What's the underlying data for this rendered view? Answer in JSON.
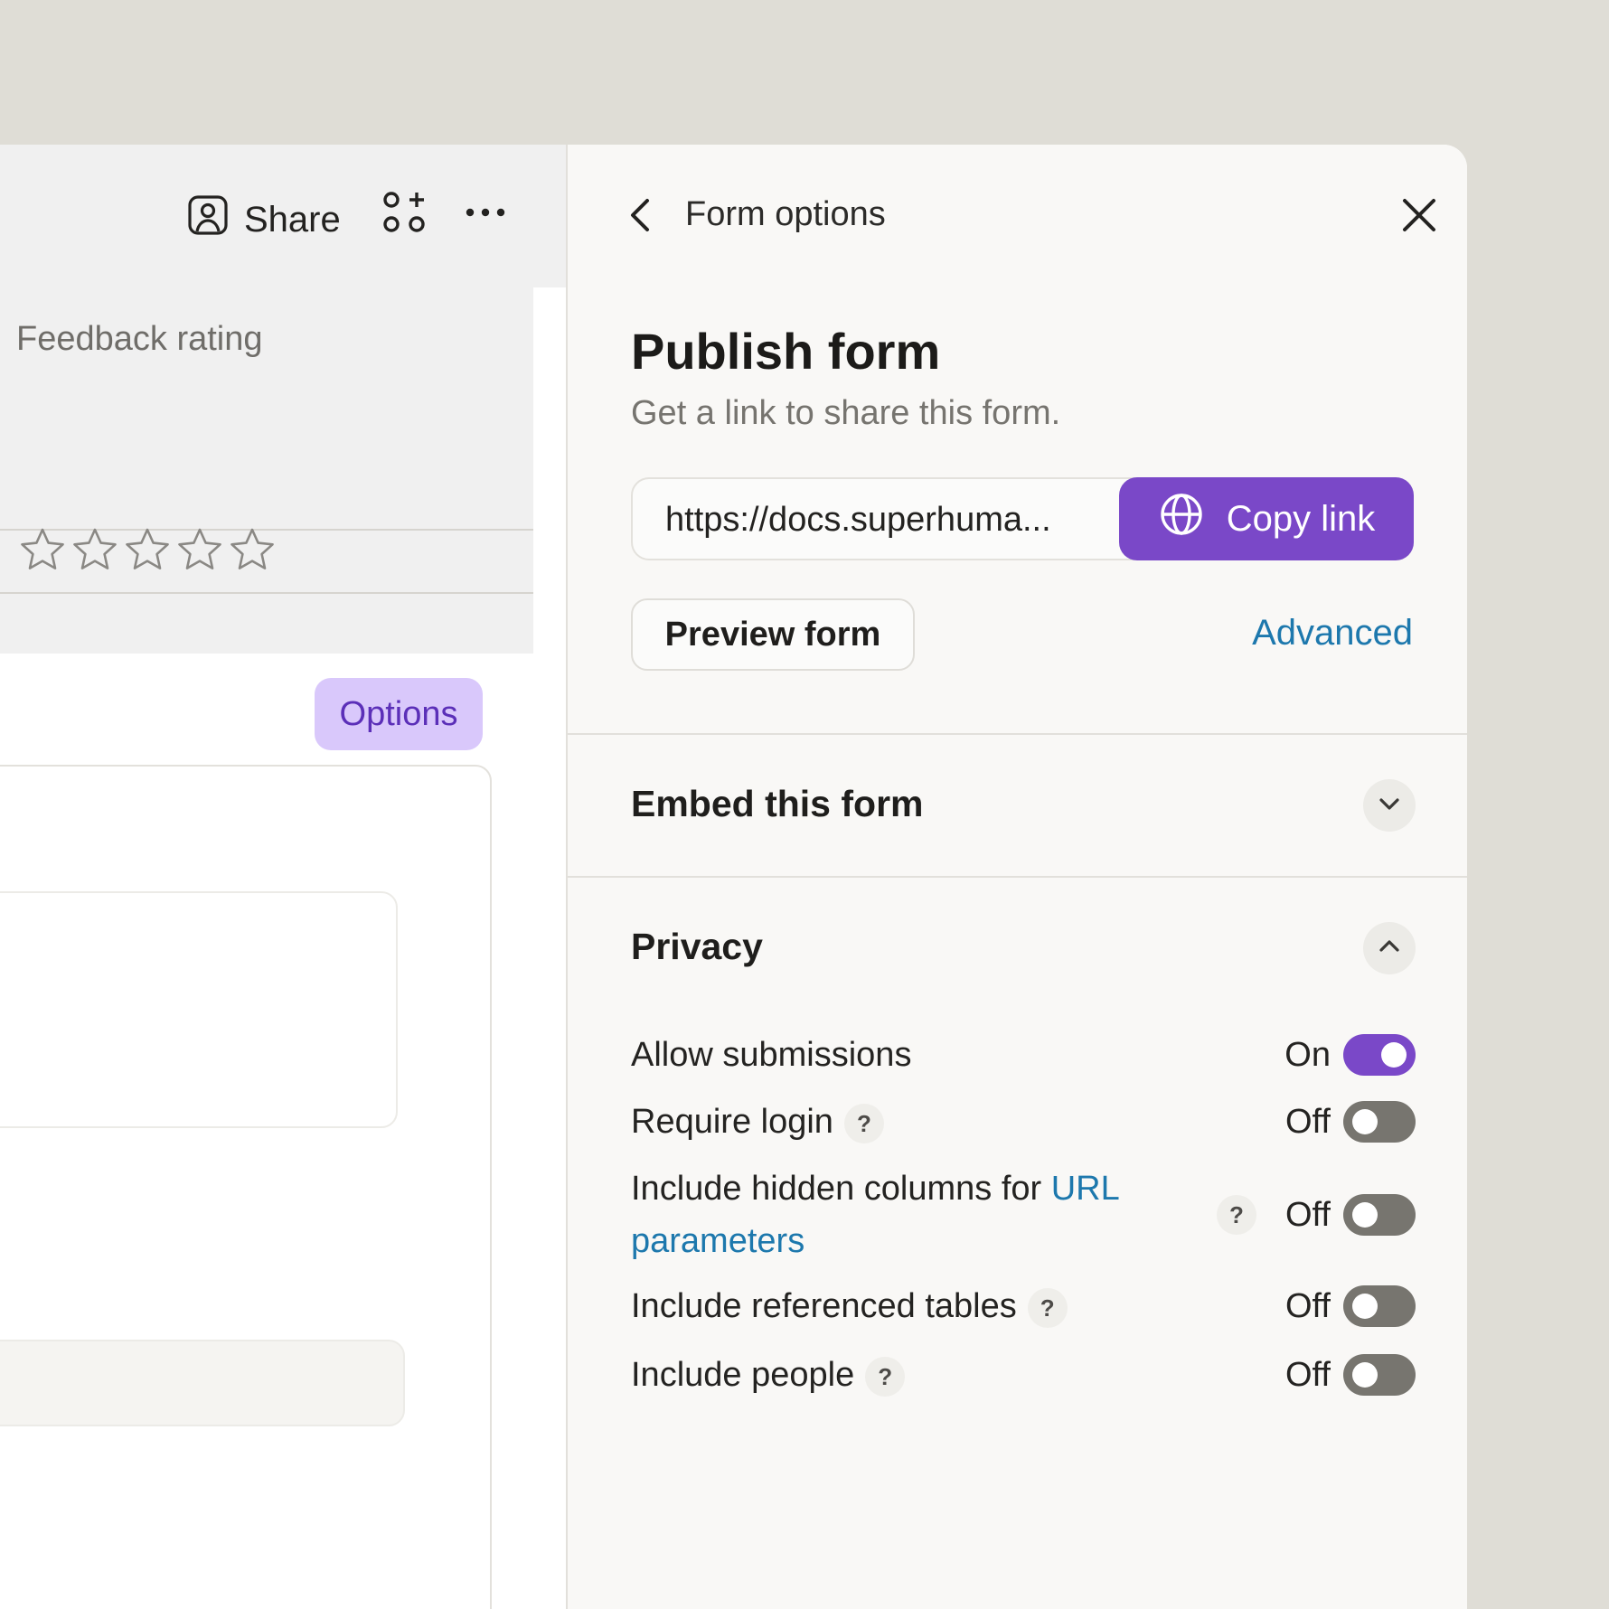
{
  "toolbar": {
    "share_label": "Share",
    "icons": [
      "user-share-icon",
      "blocks-add-icon",
      "more-icon"
    ]
  },
  "doc": {
    "field_label": "Feedback rating",
    "rating": {
      "value": 0,
      "max": 5
    },
    "options_label": "Options"
  },
  "panel": {
    "title": "Form options",
    "publish": {
      "heading": "Publish form",
      "subtitle": "Get a link to share this form.",
      "url": "https://docs.superhuma...",
      "copy_label": "Copy link",
      "preview_label": "Preview form",
      "advanced_label": "Advanced"
    },
    "embed": {
      "title": "Embed this form",
      "expanded": false
    },
    "privacy": {
      "title": "Privacy",
      "expanded": true,
      "settings": [
        {
          "label": "Allow submissions",
          "state": "On",
          "on": true,
          "help": false
        },
        {
          "label": "Require login",
          "state": "Off",
          "on": false,
          "help": true
        },
        {
          "label_prefix": "Include hidden columns for ",
          "label_link": "URL parameters",
          "state": "Off",
          "on": false,
          "help": true
        },
        {
          "label": "Include referenced tables",
          "state": "Off",
          "on": false,
          "help": true
        },
        {
          "label": "Include people",
          "state": "Off",
          "on": false,
          "help": true
        }
      ],
      "help_glyph": "?"
    }
  },
  "colors": {
    "accent": "#7a48c8",
    "link": "#1d78ad",
    "options_bg": "#d9c8fb",
    "backdrop": "#dfddd6"
  }
}
